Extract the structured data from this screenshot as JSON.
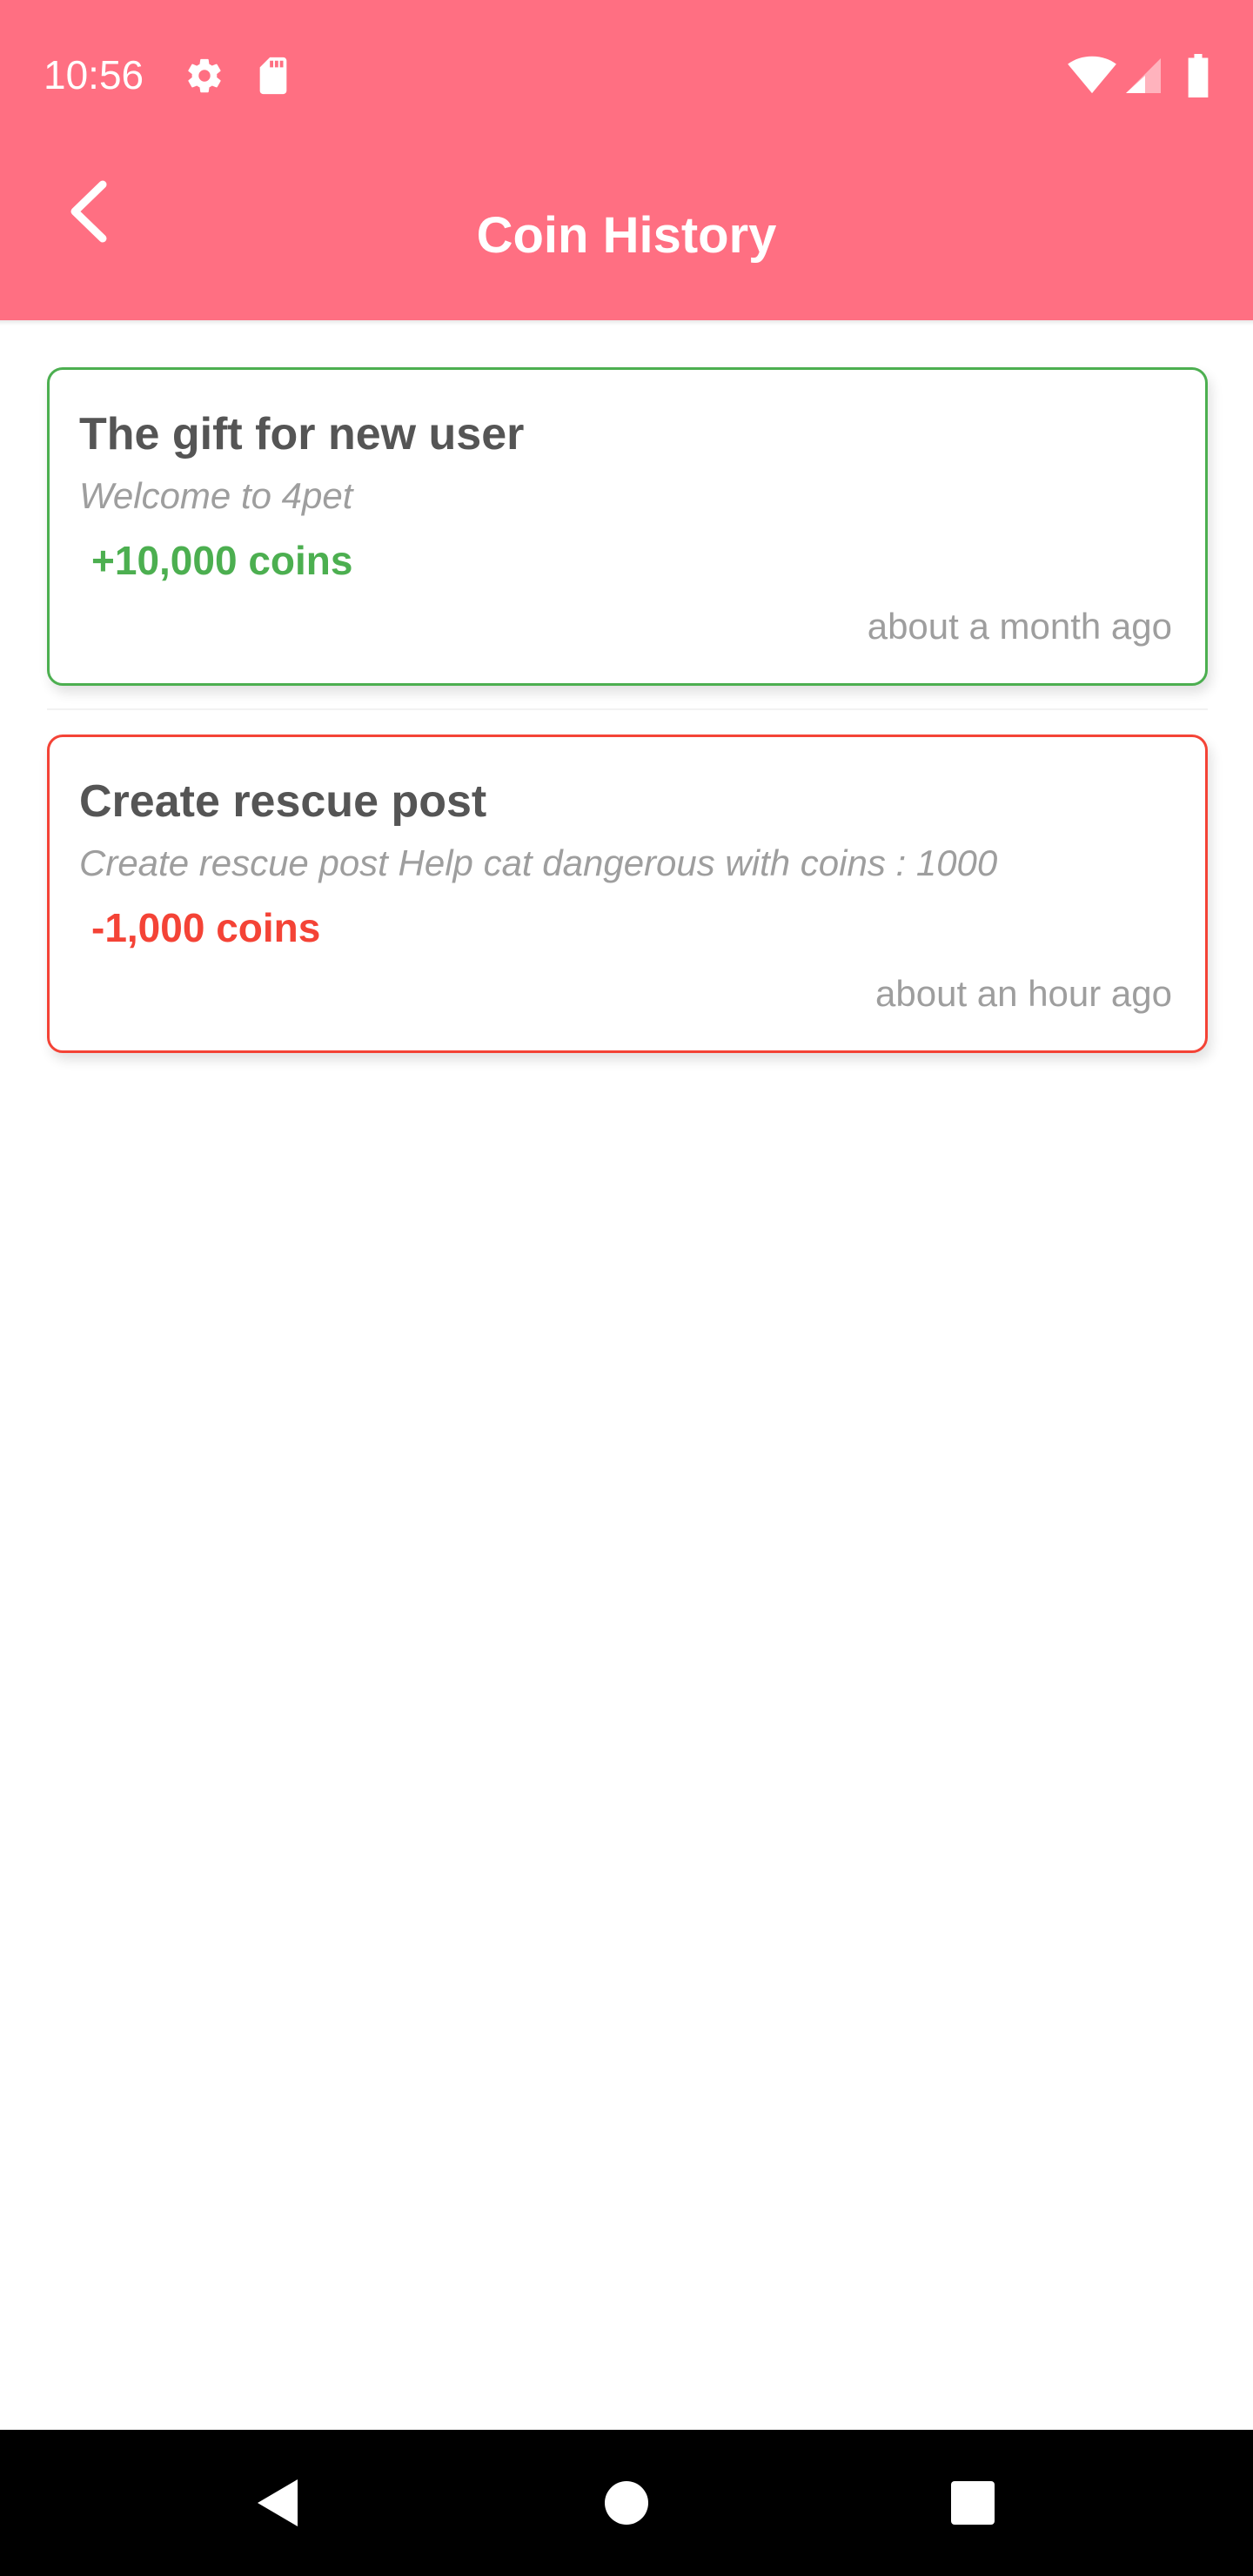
{
  "status_bar": {
    "time": "10:56",
    "icons": [
      "gear-icon",
      "sd-card-icon",
      "wifi-icon",
      "signal-icon",
      "battery-icon"
    ],
    "background": "#ff6f82"
  },
  "app_bar": {
    "title": "Coin History",
    "back_icon": "chevron-left-icon",
    "background": "#ff6f82"
  },
  "history": [
    {
      "title": "The gift for new user",
      "description": "Welcome to 4pet",
      "amount": "+10,000 coins",
      "time": "about a month ago",
      "status": "positive",
      "accent": "#4caf50"
    },
    {
      "title": "Create rescue post",
      "description": "Create rescue post Help cat dangerous  with coins : 1000",
      "amount": "-1,000 coins",
      "time": "about an hour ago",
      "status": "negative",
      "accent": "#f44336"
    }
  ],
  "nav_bar": {
    "buttons": [
      "back-triangle-icon",
      "home-circle-icon",
      "recents-square-icon"
    ]
  }
}
